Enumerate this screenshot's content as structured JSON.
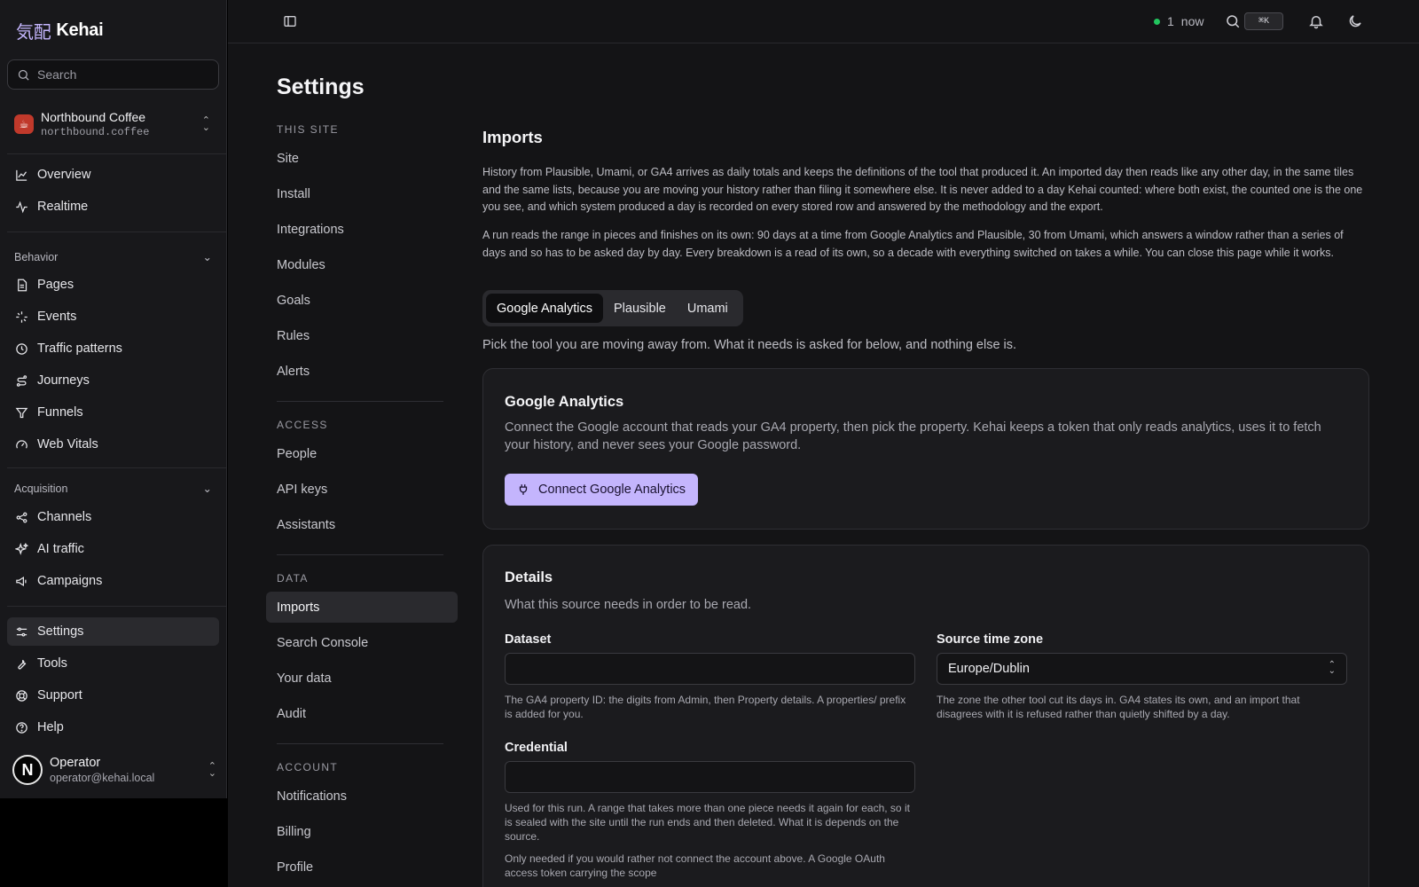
{
  "app": {
    "logo_kanji": "気配",
    "logo_name": "Kehai"
  },
  "sidebar": {
    "search_placeholder": "Search",
    "site": {
      "name": "Northbound Coffee",
      "domain": "northbound.coffee"
    },
    "top_items": [
      {
        "label": "Overview",
        "icon": "chart-line-icon"
      },
      {
        "label": "Realtime",
        "icon": "activity-icon"
      }
    ],
    "behavior": {
      "label": "Behavior",
      "items": [
        {
          "label": "Pages",
          "icon": "file-icon"
        },
        {
          "label": "Events",
          "icon": "sparkle-icon"
        },
        {
          "label": "Traffic patterns",
          "icon": "clock-icon"
        },
        {
          "label": "Journeys",
          "icon": "route-icon"
        },
        {
          "label": "Funnels",
          "icon": "funnel-icon"
        },
        {
          "label": "Web Vitals",
          "icon": "gauge-icon"
        }
      ]
    },
    "acquisition": {
      "label": "Acquisition",
      "items": [
        {
          "label": "Channels",
          "icon": "share-icon"
        },
        {
          "label": "AI traffic",
          "icon": "sparkles-icon"
        },
        {
          "label": "Campaigns",
          "icon": "megaphone-icon"
        }
      ]
    },
    "bottom_items": [
      {
        "label": "Settings",
        "icon": "sliders-icon",
        "active": true
      },
      {
        "label": "Tools",
        "icon": "wrench-icon"
      },
      {
        "label": "Support",
        "icon": "lifebuoy-icon"
      },
      {
        "label": "Help",
        "icon": "help-circle-icon"
      }
    ],
    "user": {
      "initial": "N",
      "name": "Operator",
      "email": "operator@kehai.local"
    }
  },
  "topbar": {
    "live_count": "1",
    "live_label": "now",
    "shortcut": "⌘K",
    "live_color": "#22c55e"
  },
  "settings": {
    "title": "Settings",
    "groups": [
      {
        "heading": "THIS SITE",
        "items": [
          "Site",
          "Install",
          "Integrations",
          "Modules",
          "Goals",
          "Rules",
          "Alerts"
        ]
      },
      {
        "heading": "ACCESS",
        "items": [
          "People",
          "API keys",
          "Assistants"
        ]
      },
      {
        "heading": "DATA",
        "items": [
          "Imports",
          "Search Console",
          "Your data",
          "Audit"
        ]
      },
      {
        "heading": "ACCOUNT",
        "items": [
          "Notifications",
          "Billing",
          "Profile"
        ]
      }
    ],
    "active_item": "Imports"
  },
  "imports": {
    "title": "Imports",
    "para1": "History from Plausible, Umami, or GA4 arrives as daily totals and keeps the definitions of the tool that produced it. An imported day then reads like any other day, in the same tiles and the same lists, because you are moving your history rather than filing it somewhere else. It is never added to a day Kehai counted: where both exist, the counted one is the one you see, and which system produced a day is recorded on every stored row and answered by the methodology and the export.",
    "para2": "A run reads the range in pieces and finishes on its own: 90 days at a time from Google Analytics and Plausible, 30 from Umami, which answers a window rather than a series of days and so has to be asked day by day. Every breakdown is a read of its own, so a decade with everything switched on takes a while. You can close this page while it works.",
    "tabs": [
      "Google Analytics",
      "Plausible",
      "Umami"
    ],
    "active_tab": "Google Analytics",
    "pick_help": "Pick the tool you are moving away from. What it needs is asked for below, and nothing else is.",
    "ga_card": {
      "title": "Google Analytics",
      "body": "Connect the Google account that reads your GA4 property, then pick the property. Kehai keeps a token that only reads analytics, uses it to fetch your history, and never sees your Google password.",
      "button": "Connect Google Analytics",
      "button_color": "#c4b5fd"
    },
    "details": {
      "title": "Details",
      "subtitle": "What this source needs in order to be read.",
      "dataset_label": "Dataset",
      "dataset_value": "",
      "dataset_help": "The GA4 property ID: the digits from Admin, then Property details. A properties/ prefix is added for you.",
      "tz_label": "Source time zone",
      "tz_value": "Europe/Dublin",
      "tz_help": "The zone the other tool cut its days in. GA4 states its own, and an import that disagrees with it is refused rather than quietly shifted by a day.",
      "credential_label": "Credential",
      "credential_value": "",
      "credential_help": "Used for this run. A range that takes more than one piece needs it again for each, so it is sealed with the site until the run ends and then deleted. What it is depends on the source.",
      "credential_help2": "Only needed if you would rather not connect the account above. A Google OAuth access token carrying the scope"
    }
  }
}
